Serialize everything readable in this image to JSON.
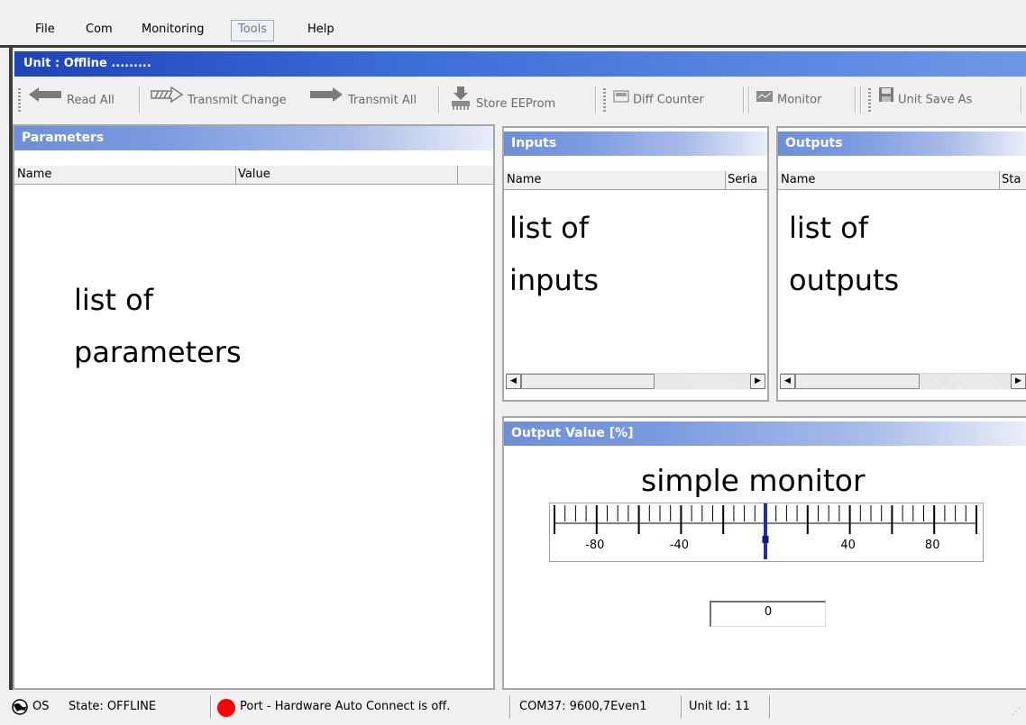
{
  "menu": {
    "items": [
      "File",
      "Com",
      "Monitoring",
      "Tools",
      "Help"
    ]
  },
  "unit_bar": {
    "title": "Unit : Offline ........."
  },
  "toolbar": {
    "read_all": "Read All",
    "transmit_change": "Transmit Change",
    "transmit_all": "Transmit All",
    "store_eeprom": "Store EEProm",
    "diff_counter": "Diff Counter",
    "monitor": "Monitor",
    "unit_save_as": "Unit Save As"
  },
  "parameters": {
    "title": "Parameters",
    "columns": [
      "Name",
      "Value"
    ],
    "annotation": [
      "list of",
      "parameters"
    ]
  },
  "inputs": {
    "title": "Inputs",
    "columns": [
      "Name",
      "Seria"
    ],
    "annotation": [
      "list of",
      "inputs"
    ]
  },
  "outputs": {
    "title": "Outputs",
    "columns": [
      "Name",
      "Sta"
    ],
    "annotation": [
      "list of",
      "outputs"
    ]
  },
  "monitor": {
    "title": "Output Value [%]",
    "annotation": "simple monitor",
    "scale_labels": [
      "-80",
      "-40",
      "40",
      "80"
    ],
    "scale_min": -100,
    "scale_max": 100,
    "needle_value": 0,
    "value": "0",
    "needle_color": "#1f2fb0"
  },
  "status": {
    "os": "OS",
    "state": "State: OFFLINE",
    "port": "Port - Hardware Auto Connect is off.",
    "com": "COM37: 9600,7Even1",
    "unit_id": "Unit Id: 11",
    "port_indicator_color": "#ff0000"
  }
}
